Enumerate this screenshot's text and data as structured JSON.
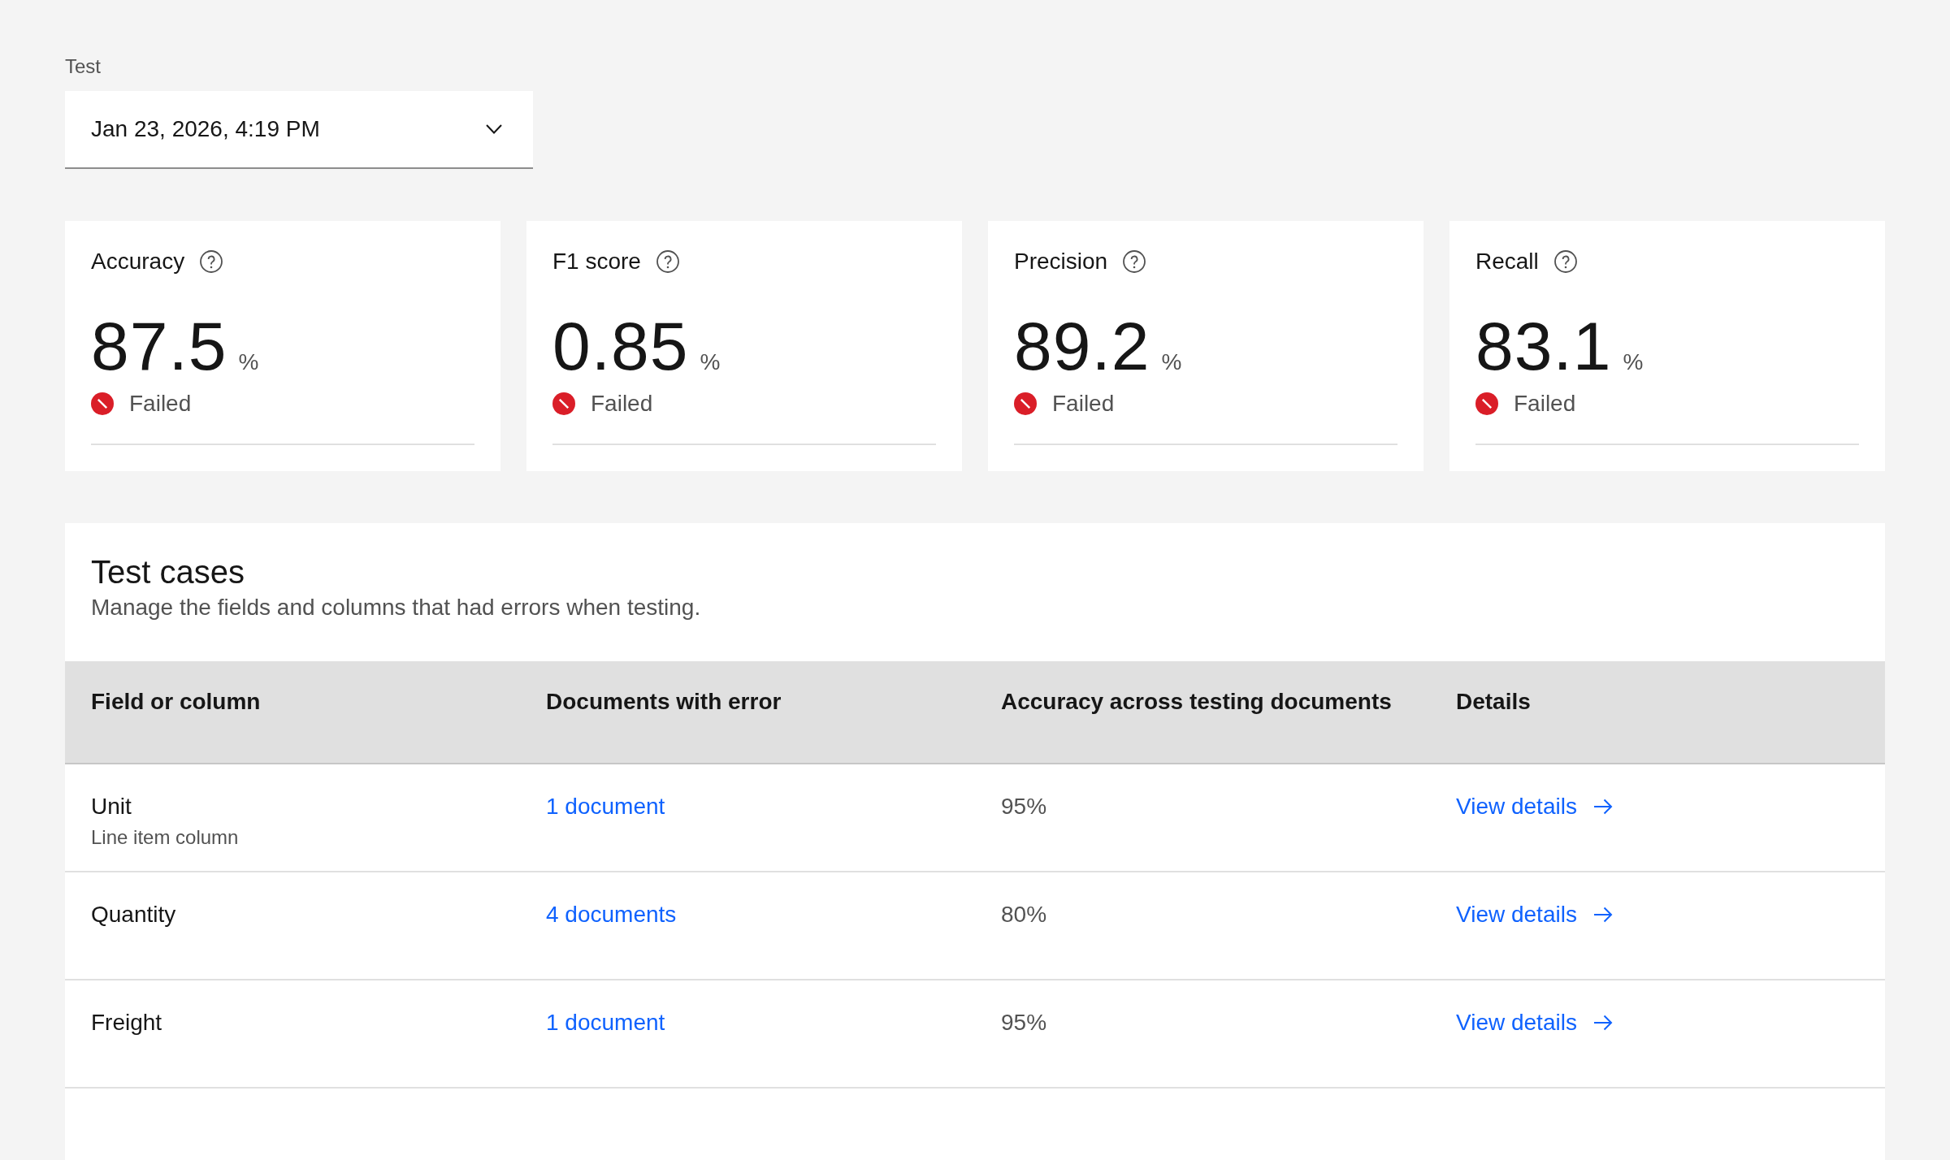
{
  "test_select": {
    "label": "Test",
    "value": "Jan 23, 2026, 4:19 PM"
  },
  "metrics": [
    {
      "title": "Accuracy",
      "value": "87.5",
      "unit": "%",
      "status": {
        "kind": "failed",
        "label": "Failed"
      }
    },
    {
      "title": "F1 score",
      "value": "0.85",
      "unit": "%",
      "status": {
        "kind": "failed",
        "label": "Failed"
      }
    },
    {
      "title": "Precision",
      "value": "89.2",
      "unit": "%",
      "status": {
        "kind": "failed",
        "label": "Failed"
      }
    },
    {
      "title": "Recall",
      "value": "83.1",
      "unit": "%",
      "status": {
        "kind": "failed",
        "label": "Failed"
      }
    }
  ],
  "test_cases": {
    "title": "Test cases",
    "description": "Manage the fields and columns that had errors when testing.",
    "columns": [
      "Field or column",
      "Documents with error",
      "Accuracy across testing documents",
      "Details"
    ],
    "rows": [
      {
        "field": "Unit",
        "field_type": "Line item column",
        "documents": "1 document",
        "accuracy": "95%",
        "details": "View details"
      },
      {
        "field": "Quantity",
        "documents": "4 documents",
        "accuracy": "80%",
        "details": "View details"
      },
      {
        "field": "Freight",
        "documents": "1 document",
        "accuracy": "95%",
        "details": "View details"
      }
    ]
  }
}
